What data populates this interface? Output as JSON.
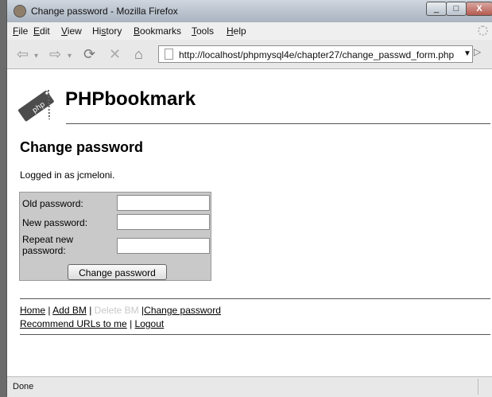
{
  "window": {
    "title": "Change password - Mozilla Firefox",
    "controls": [
      "_",
      "□",
      "X"
    ]
  },
  "menu": [
    {
      "accesskey": "F",
      "rest": "ile"
    },
    {
      "accesskey": "E",
      "rest": "dit"
    },
    {
      "accesskey": "V",
      "rest": "iew"
    },
    {
      "prefix": "Hi",
      "accesskey": "s",
      "rest": "tory"
    },
    {
      "accesskey": "B",
      "rest": "ookmarks"
    },
    {
      "accesskey": "T",
      "rest": "ools"
    },
    {
      "accesskey": "H",
      "rest": "elp"
    }
  ],
  "nav": {
    "back": "⇦",
    "back_dropdown": "▾",
    "forward": "⇨",
    "forward_dropdown": "▾",
    "reload": "⟳",
    "stop": "✕",
    "home": "⌂",
    "url": "http://localhost/phpmysql4e/chapter27/change_passwd_form.php",
    "url_dropdown": "▼",
    "go": "▷"
  },
  "page": {
    "brand": "PHPbookmark",
    "heading": "Change password",
    "logged_in_text": "Logged in as jcmeloni.",
    "form": {
      "old_password_label": "Old password:",
      "new_password_label": "New password:",
      "repeat_password_label": "Repeat new password:",
      "submit_label": "Change password"
    },
    "links": {
      "home": "Home",
      "add_bm": "Add BM",
      "delete_bm": "Delete BM",
      "change_password": "Change password",
      "recommend": "Recommend URLs to me",
      "logout": "Logout"
    },
    "separators": [
      "|",
      "|",
      "|",
      "|"
    ]
  },
  "status": {
    "text": "Done"
  },
  "icons": {
    "window": "firefox-icon",
    "logo": "php-tag-logo",
    "page": "page-icon",
    "spinner": "throbber-icon"
  },
  "colors": {
    "form_panel": "#c9c9c9",
    "disabled_link": "#c8c8c8",
    "brand_text": "#000000"
  }
}
